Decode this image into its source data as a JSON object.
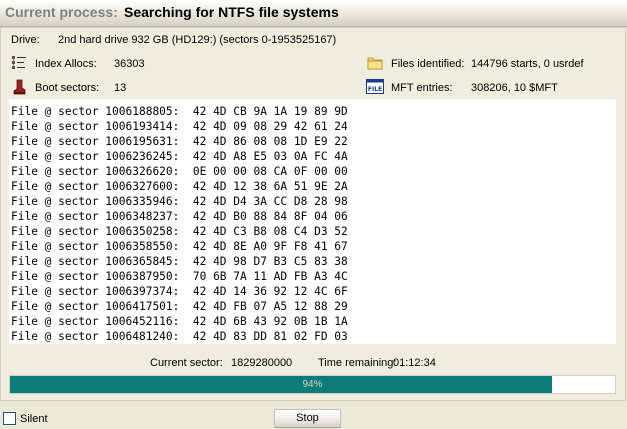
{
  "header": {
    "label": "Current process:",
    "value": "Searching for NTFS file systems"
  },
  "drive": {
    "label": "Drive:",
    "value": "2nd hard drive 932 GB (HD129:) (sectors 0-1953525167)"
  },
  "stats": {
    "index_allocs": {
      "label": "Index Allocs:",
      "value": "36303",
      "icon": "index-alloc-icon"
    },
    "boot_sectors": {
      "label": "Boot sectors:",
      "value": "13",
      "icon": "boot-sector-icon"
    },
    "files_identified": {
      "label": "Files identified:",
      "value": "144796 starts, 0 usrdef",
      "icon": "folder-icon"
    },
    "mft_entries": {
      "label": "MFT entries:",
      "value": "308206, 10 $MFT",
      "icon": "file-icon"
    }
  },
  "log_lines": [
    "File @ sector 1006188805:  42 4D CB 9A 1A 19 89 9D",
    "File @ sector 1006193414:  42 4D 09 08 29 42 61 24",
    "File @ sector 1006195631:  42 4D 86 08 08 1D E9 22",
    "File @ sector 1006236245:  42 4D A8 E5 03 0A FC 4A",
    "File @ sector 1006326620:  0E 00 00 08 CA 0F 00 00",
    "File @ sector 1006327600:  42 4D 12 38 6A 51 9E 2A",
    "File @ sector 1006335946:  42 4D D4 3A CC D8 28 98",
    "File @ sector 1006348237:  42 4D B0 88 84 8F 04 06",
    "File @ sector 1006350258:  42 4D C3 B8 08 C4 D3 52",
    "File @ sector 1006358550:  42 4D 8E A0 9F F8 41 67",
    "File @ sector 1006365845:  42 4D 98 D7 B3 C5 83 38",
    "File @ sector 1006387950:  70 6B 7A 11 AD FB A3 4C",
    "File @ sector 1006397374:  42 4D 14 36 92 12 4C 6F",
    "File @ sector 1006417501:  42 4D FB 07 A5 12 88 29",
    "File @ sector 1006452116:  42 4D 6B 43 92 0B 1B 1A",
    "File @ sector 1006481240:  42 4D 83 DD 81 02 FD 03"
  ],
  "status": {
    "current_sector_label": "Current sector:",
    "current_sector_value": "1829280000",
    "time_remaining_label": "Time remaining:",
    "time_remaining_value": "01:12:34"
  },
  "progress": {
    "percent": 94,
    "label": "94%",
    "color": "#0c7c7a"
  },
  "silent": {
    "label": "Silent",
    "checked": false
  },
  "stop_button": {
    "label": "Stop"
  }
}
